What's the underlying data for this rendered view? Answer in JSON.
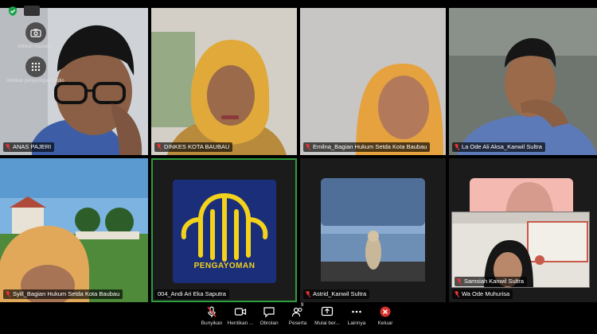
{
  "overlay": {
    "camera_label": "Alihkan Kamera",
    "apps_label": "Aktifkan penyaringan Audio"
  },
  "participants": [
    {
      "name": "ANAS PAJERI"
    },
    {
      "name": "DINKES KOTA BAUBAU"
    },
    {
      "name": "Emilna_Bagian Hukum Setda Kota Baubau"
    },
    {
      "name": "La Ode Ali Aksa_Kanwil Sultra"
    },
    {
      "name": "Syill_Bagian Hukum Setda Kota Baubau"
    },
    {
      "name": "004_Andi Ari Eka Saputra"
    },
    {
      "name": "Astrid_Kanwil Sultra"
    },
    {
      "name": "Wa Ode Muhurisa"
    },
    {
      "name": "Samsiah Kanwil Sultra"
    }
  ],
  "logo": {
    "text": "PENGAYOMAN"
  },
  "toolbar": {
    "mute": "Bunyikan",
    "stop_video": "Hentikan ...",
    "chat": "Obrolan",
    "participants": "Peserta",
    "participants_count": "9",
    "share": "Mulai ber...",
    "more": "Lainnya",
    "leave": "Keluar"
  },
  "colors": {
    "active_speaker": "#2e9e3e",
    "logo_bg": "#1a2e7a",
    "logo_gold": "#f2d21c",
    "leave": "#d9302c"
  }
}
